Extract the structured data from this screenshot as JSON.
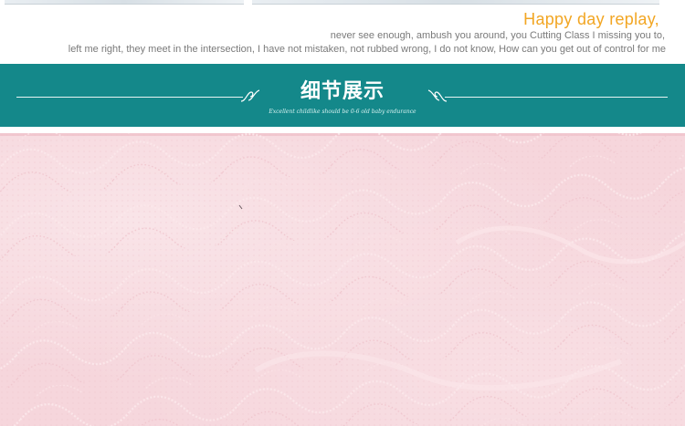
{
  "header": {
    "headline": "Happy day replay,",
    "tagline_line1": "never see enough, ambush you around, you Cutting Class I missing you to,",
    "tagline_line2": "left me right, they meet in the intersection, I have not mistaken, not rubbed wrong, I do not know, How can you get out of control for me"
  },
  "banner": {
    "title": "细节展示",
    "subtitle": "Excellent childlike should be 0-6 old baby endurance",
    "background_color": "#14888a"
  },
  "detail_image": {
    "color": "#f6d6dc"
  },
  "accent_color": "#f2a623"
}
